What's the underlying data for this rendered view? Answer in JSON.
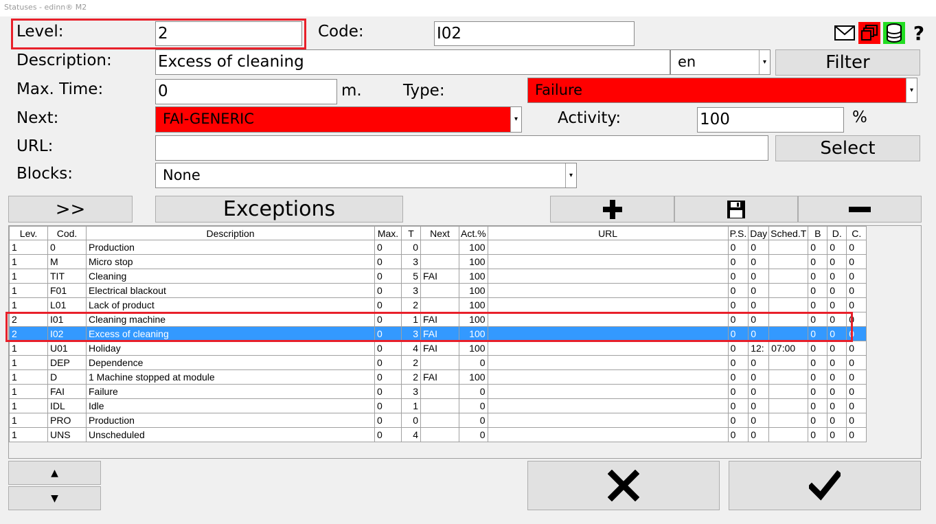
{
  "window": {
    "title": "Statuses - edinn® M2"
  },
  "form": {
    "level_label": "Level:",
    "level_value": "2",
    "code_label": "Code:",
    "code_value": "I02",
    "description_label": "Description:",
    "description_value": "Excess of cleaning",
    "language_value": "en",
    "filter_label": "Filter",
    "max_time_label": "Max. Time:",
    "max_time_value": "0",
    "max_time_unit": "m.",
    "type_label": "Type:",
    "type_value": "Failure",
    "next_label": "Next:",
    "next_value": "FAI-GENERIC",
    "activity_label": "Activity:",
    "activity_value": "100",
    "activity_unit": "%",
    "url_label": "URL:",
    "url_value": "",
    "select_label": "Select",
    "blocks_label": "Blocks:",
    "blocks_value": "None"
  },
  "toolbar": {
    "forward_label": ">>",
    "exceptions_label": "Exceptions",
    "add_glyph": "✚",
    "save_glyph": "💾",
    "remove_glyph": "—"
  },
  "icons": [
    "mail-icon",
    "windows-icon",
    "database-icon",
    "help-icon"
  ],
  "help_glyph": "?",
  "accent_colors": {
    "red": "#ff0000",
    "selection": "#3399ff",
    "highlight": "#e8202a",
    "db_green": "#22dd22"
  },
  "table": {
    "columns": [
      "Lev.",
      "Cod.",
      "Description",
      "Max.",
      "T",
      "Next",
      "Act.%",
      "URL",
      "P.S.",
      "Day",
      "Sched.T",
      "B",
      "D.",
      "C."
    ],
    "rows": [
      [
        "1",
        "0",
        "Production",
        "0",
        "0",
        "",
        "100",
        "",
        "0",
        "0",
        "",
        "0",
        "0",
        "0"
      ],
      [
        "1",
        "M",
        "Micro stop",
        "0",
        "3",
        "",
        "100",
        "",
        "0",
        "0",
        "",
        "0",
        "0",
        "0"
      ],
      [
        "1",
        "TIT",
        "Cleaning",
        "0",
        "5",
        "FAI",
        "100",
        "",
        "0",
        "0",
        "",
        "0",
        "0",
        "0"
      ],
      [
        "1",
        "F01",
        "Electrical blackout",
        "0",
        "3",
        "",
        "100",
        "",
        "0",
        "0",
        "",
        "0",
        "0",
        "0"
      ],
      [
        "1",
        "L01",
        "Lack of product",
        "0",
        "2",
        "",
        "100",
        "",
        "0",
        "0",
        "",
        "0",
        "0",
        "0"
      ],
      [
        "2",
        "I01",
        "Cleaning machine",
        "0",
        "1",
        "FAI",
        "100",
        "",
        "0",
        "0",
        "",
        "0",
        "0",
        "0"
      ],
      [
        "2",
        "I02",
        "Excess of cleaning",
        "0",
        "3",
        "FAI",
        "100",
        "",
        "0",
        "0",
        "",
        "0",
        "0",
        "0"
      ],
      [
        "1",
        "U01",
        "Holiday",
        "0",
        "4",
        "FAI",
        "100",
        "",
        "0",
        "12:",
        "07:00",
        "0",
        "0",
        "0"
      ],
      [
        "1",
        "DEP",
        "Dependence",
        "0",
        "2",
        "",
        "0",
        "",
        "0",
        "0",
        "",
        "0",
        "0",
        "0"
      ],
      [
        "1",
        "D",
        "1 Machine stopped at module",
        "0",
        "2",
        "FAI",
        "100",
        "",
        "0",
        "0",
        "",
        "0",
        "0",
        "0"
      ],
      [
        "1",
        "FAI",
        "Failure",
        "0",
        "3",
        "",
        "0",
        "",
        "0",
        "0",
        "",
        "0",
        "0",
        "0"
      ],
      [
        "1",
        "IDL",
        "Idle",
        "0",
        "1",
        "",
        "0",
        "",
        "0",
        "0",
        "",
        "0",
        "0",
        "0"
      ],
      [
        "1",
        "PRO",
        "Production",
        "0",
        "0",
        "",
        "0",
        "",
        "0",
        "0",
        "",
        "0",
        "0",
        "0"
      ],
      [
        "1",
        "UNS",
        "Unscheduled",
        "0",
        "4",
        "",
        "0",
        "",
        "0",
        "0",
        "",
        "0",
        "0",
        "0"
      ]
    ],
    "selected_row": 6
  },
  "bottom": {
    "up_glyph": "▲",
    "down_glyph": "▼",
    "cancel_glyph": "✖",
    "ok_glyph": "✔"
  }
}
